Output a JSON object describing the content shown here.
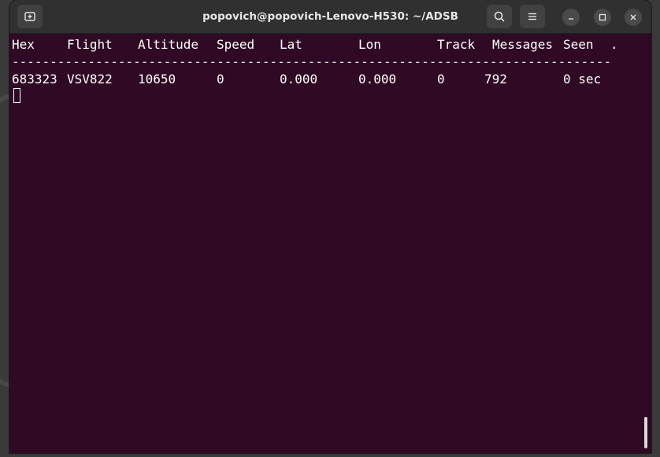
{
  "window": {
    "title": "popovich@popovich-Lenovo-H530: ~/ADSB"
  },
  "terminal": {
    "columns": [
      "Hex",
      "Flight",
      "Altitude",
      "Speed",
      "Lat",
      "Lon",
      "Track",
      "Messages",
      "Seen",
      "."
    ],
    "separator": "-------------------------------------------------------------------------------",
    "rows": [
      {
        "hex": "683323",
        "flight": "VSV822",
        "altitude": "10650",
        "speed": "0",
        "lat": "0.000",
        "lon": "0.000",
        "track": "0",
        "messages": "792",
        "seen": "0 sec"
      }
    ]
  },
  "icons": {
    "new_tab": "new-tab-icon",
    "search": "search-icon",
    "menu": "hamburger-menu-icon",
    "minimize": "minimize-icon",
    "maximize": "maximize-icon",
    "close": "close-icon"
  },
  "colors": {
    "terminal_bg": "#300a24",
    "titlebar_bg": "#303030",
    "text": "#ffffff"
  }
}
